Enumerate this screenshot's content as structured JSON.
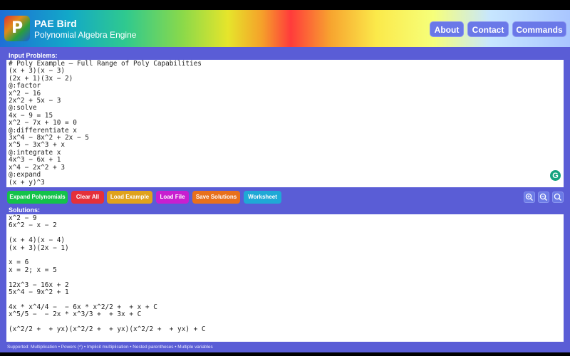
{
  "app": {
    "logo_letter": "P",
    "title": "PAE Bird",
    "subtitle": "Polynomial Algebra Engine"
  },
  "nav": {
    "about": "About",
    "contact": "Contact",
    "commands": "Commands"
  },
  "input": {
    "label": "Input Problems:",
    "lines": [
      "# Poly Example — Full Range of Poly Capabilities",
      "(x + 3)(x − 3)",
      "(2x + 1)(3x − 2)",
      "@:factor",
      "x^2 − 16",
      "2x^2 + 5x − 3",
      "@:solve",
      "4x − 9 = 15",
      "x^2 − 7x + 10 = 0",
      "@:differentiate x",
      "3x^4 − 8x^2 + 2x − 5",
      "x^5 − 3x^3 + x",
      "@:integrate x",
      "4x^3 − 6x + 1",
      "x^4 − 2x^2 + 3",
      "@:expand",
      "(x + y)^3"
    ]
  },
  "actions": {
    "expand": "Expand Polynomials",
    "clear": "Clear All",
    "load_example": "Load Example",
    "load_file": "Load File",
    "save": "Save Solutions",
    "worksheet": "Worksheet"
  },
  "colors": {
    "expand": "#14c24a",
    "clear": "#e5303a",
    "load_example": "#e0a21c",
    "load_file": "#c81fd0",
    "save": "#e8701c",
    "worksheet": "#1fa9d6"
  },
  "icons": {
    "zoom_in": "zoom-in-icon",
    "zoom_out": "zoom-out-icon",
    "zoom_reset": "zoom-reset-icon",
    "grammarly": "grammarly-icon"
  },
  "solutions": {
    "label": "Solutions:",
    "lines": [
      "x^2 − 9",
      "6x^2 − x − 2",
      "",
      "(x + 4)(x − 4)",
      "(x + 3)(2x − 1)",
      "",
      "x = 6",
      "x = 2; x = 5",
      "",
      "12x^3 − 16x + 2",
      "5x^4 − 9x^2 + 1",
      "",
      "4x * x^4/4 −  − 6x * x^2/2 +  + x + C",
      "x^5/5 −  − 2x * x^3/3 +  + 3x + C",
      "",
      "(x^2/2 +  + yx)(x^2/2 +  + yx)(x^2/2 +  + yx) + C"
    ]
  },
  "footer": {
    "text": "Supported: Multiplication • Powers (^) • Implicit multiplication • Nested parentheses • Multiple variables"
  }
}
